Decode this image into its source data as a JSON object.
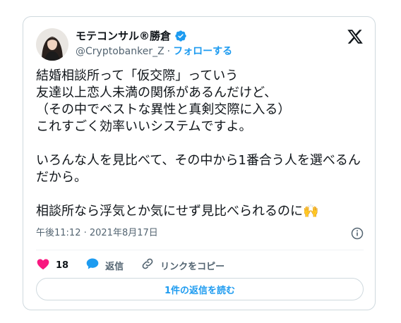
{
  "tweet": {
    "author_name": "モテコンサル®勝倉",
    "handle": "@Cryptobanker_Z",
    "separator": "·",
    "follow_label": "フォローする",
    "text": "結婚相談所って「仮交際」っていう\n友達以上恋人未満の関係があるんだけど、\n（その中でベストな異性と真剣交際に入る）\nこれすごく効率いいシステムですよ。\n\nいろんな人を見比べて、その中から1番合う人を選べるんだから。\n\n相談所なら浮気とか気にせず見比べられるのに🙌",
    "timestamp": "午後11:12 · 2021年8月17日",
    "like_count": "18",
    "reply_label": "返信",
    "copy_link_label": "リンクをコピー",
    "read_replies_label": "1件の返信を読む"
  },
  "icons": {
    "verified": "verified-badge-icon",
    "x_logo": "x-logo-icon",
    "info": "info-icon",
    "like": "heart-icon",
    "reply": "speech-bubble-icon",
    "link": "link-icon"
  },
  "colors": {
    "accent": "#1d9bf0",
    "like": "#f91880",
    "text": "#0f1419",
    "secondary": "#536471",
    "border": "#cfd9de"
  }
}
